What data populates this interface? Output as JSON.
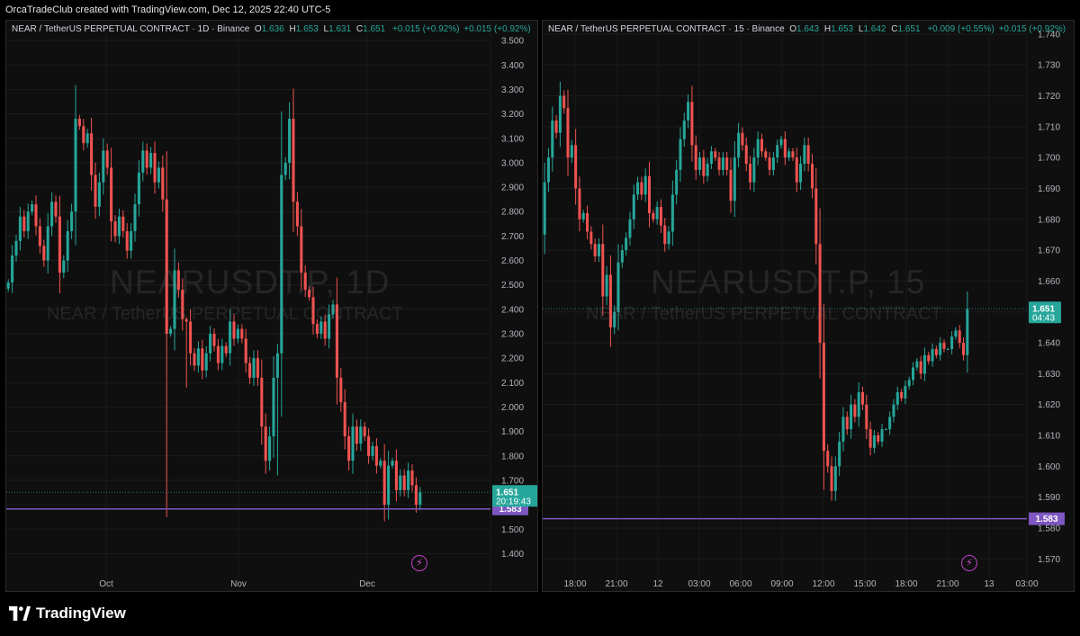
{
  "header": {
    "caption": "OrcaTradeClub created with TradingView.com, Dec 12, 2025 22:40 UTC-5"
  },
  "footer": {
    "brand": "TradingView"
  },
  "colors": {
    "up": "#26a69a",
    "down": "#ef5350",
    "level_line": "#7e57c2",
    "background": "#0f0f0f"
  },
  "charts": {
    "left": {
      "symbol_title": "NEAR / TetherUS PERPETUAL CONTRACT · 1D · Binance",
      "ohlc": {
        "o_label": "O",
        "o": "1.636",
        "h_label": "H",
        "h": "1.653",
        "l_label": "L",
        "l": "1.631",
        "c_label": "C",
        "c": "1.651",
        "change": "+0.015 (+0.92%)",
        "change2": "+0.015 (+0.92%)"
      },
      "watermark": {
        "ticker": "NEARUSDT.P, 1D",
        "name": "NEAR / TetherUS PERPETUAL CONTRACT"
      },
      "price_label": {
        "price": "1.651",
        "countdown": "20:19:43"
      },
      "level_label": "1.583"
    },
    "right": {
      "symbol_title": "NEAR / TetherUS PERPETUAL CONTRACT · 15 · Binance",
      "ohlc": {
        "o_label": "O",
        "o": "1.643",
        "h_label": "H",
        "h": "1.653",
        "l_label": "L",
        "l": "1.642",
        "c_label": "C",
        "c": "1.651",
        "change": "+0.009 (+0.55%)",
        "change2": "+0.015 (+0.92%)"
      },
      "watermark": {
        "ticker": "NEARUSDT.P, 15",
        "name": "NEAR / TetherUS PERPETUAL CONTRACT"
      },
      "price_label": {
        "price": "1.651",
        "countdown": "04:43"
      },
      "level_label": "1.583"
    }
  },
  "chart_data": [
    {
      "type": "candlestick",
      "title": "NEAR / TetherUS PERPETUAL CONTRACT · 1D · Binance",
      "ylim": [
        1.35,
        3.53
      ],
      "y_ticks": [
        "3.500",
        "3.400",
        "3.300",
        "3.200",
        "3.100",
        "3.000",
        "2.900",
        "2.800",
        "2.700",
        "2.600",
        "2.500",
        "2.400",
        "2.300",
        "2.200",
        "2.100",
        "2.000",
        "1.900",
        "1.800",
        "1.700",
        "1.600",
        "1.500",
        "1.400"
      ],
      "x_ticks": [
        "Oct",
        "Nov",
        "Dec"
      ],
      "last_price": 1.651,
      "horizontal_level": 1.583,
      "closes": [
        2.51,
        2.62,
        2.68,
        2.78,
        2.72,
        2.8,
        2.83,
        2.74,
        2.66,
        2.6,
        2.74,
        2.84,
        2.78,
        2.55,
        2.6,
        2.72,
        2.8,
        3.18,
        3.15,
        3.08,
        3.12,
        2.95,
        2.82,
        2.92,
        3.05,
        2.98,
        2.76,
        2.7,
        2.78,
        2.72,
        2.64,
        2.72,
        2.83,
        2.96,
        3.05,
        2.98,
        3.04,
        2.92,
        2.98,
        2.85,
        2.3,
        2.32,
        2.56,
        2.48,
        2.36,
        2.35,
        2.22,
        2.17,
        2.24,
        2.15,
        2.22,
        2.3,
        2.25,
        2.18,
        2.25,
        2.22,
        2.35,
        2.28,
        2.32,
        2.28,
        2.18,
        2.12,
        2.2,
        2.12,
        1.92,
        1.78,
        1.88,
        2.12,
        2.22,
        2.95,
        3.0,
        3.18,
        2.84,
        2.74,
        2.55,
        2.48,
        2.45,
        2.34,
        2.3,
        2.35,
        2.28,
        2.38,
        2.42,
        2.12,
        2.02,
        1.88,
        1.78,
        1.92,
        1.85,
        1.92,
        1.88,
        1.8,
        1.84,
        1.76,
        1.78,
        1.6,
        1.76,
        1.78,
        1.66,
        1.72,
        1.66,
        1.74,
        1.68,
        1.6,
        1.651
      ],
      "lows": {
        "40": 1.55,
        "45": 2.08,
        "68": 1.72,
        "105": 1.6
      }
    },
    {
      "type": "candlestick",
      "title": "NEAR / TetherUS PERPETUAL CONTRACT · 15 · Binance",
      "ylim": [
        1.566,
        1.742
      ],
      "y_ticks": [
        "1.740",
        "1.730",
        "1.720",
        "1.710",
        "1.700",
        "1.690",
        "1.680",
        "1.670",
        "1.660",
        "1.650",
        "1.640",
        "1.630",
        "1.620",
        "1.610",
        "1.600",
        "1.590",
        "1.580",
        "1.570"
      ],
      "x_ticks": [
        "18:00",
        "21:00",
        "12",
        "03:00",
        "06:00",
        "09:00",
        "12:00",
        "15:00",
        "18:00",
        "21:00",
        "13",
        "03:00"
      ],
      "last_price": 1.651,
      "horizontal_level": 1.583,
      "closes": [
        1.692,
        1.7,
        1.712,
        1.708,
        1.72,
        1.716,
        1.7,
        1.704,
        1.69,
        1.68,
        1.682,
        1.676,
        1.672,
        1.668,
        1.672,
        1.655,
        1.662,
        1.645,
        1.65,
        1.666,
        1.67,
        1.674,
        1.68,
        1.688,
        1.692,
        1.688,
        1.694,
        1.682,
        1.68,
        1.684,
        1.678,
        1.672,
        1.676,
        1.688,
        1.696,
        1.706,
        1.712,
        1.718,
        1.704,
        1.696,
        1.7,
        1.694,
        1.698,
        1.702,
        1.7,
        1.696,
        1.7,
        1.696,
        1.686,
        1.7,
        1.708,
        1.704,
        1.698,
        1.692,
        1.7,
        1.706,
        1.702,
        1.7,
        1.696,
        1.7,
        1.704,
        1.706,
        1.7,
        1.702,
        1.7,
        1.692,
        1.698,
        1.704,
        1.698,
        1.69,
        1.672,
        1.64,
        1.605,
        1.6,
        1.592,
        1.6,
        1.608,
        1.616,
        1.612,
        1.62,
        1.616,
        1.624,
        1.62,
        1.612,
        1.606,
        1.61,
        1.608,
        1.612,
        1.612,
        1.616,
        1.62,
        1.624,
        1.622,
        1.626,
        1.628,
        1.632,
        1.634,
        1.63,
        1.636,
        1.634,
        1.638,
        1.636,
        1.64,
        1.638,
        1.638,
        1.642,
        1.644,
        1.64,
        1.636,
        1.651
      ]
    }
  ]
}
